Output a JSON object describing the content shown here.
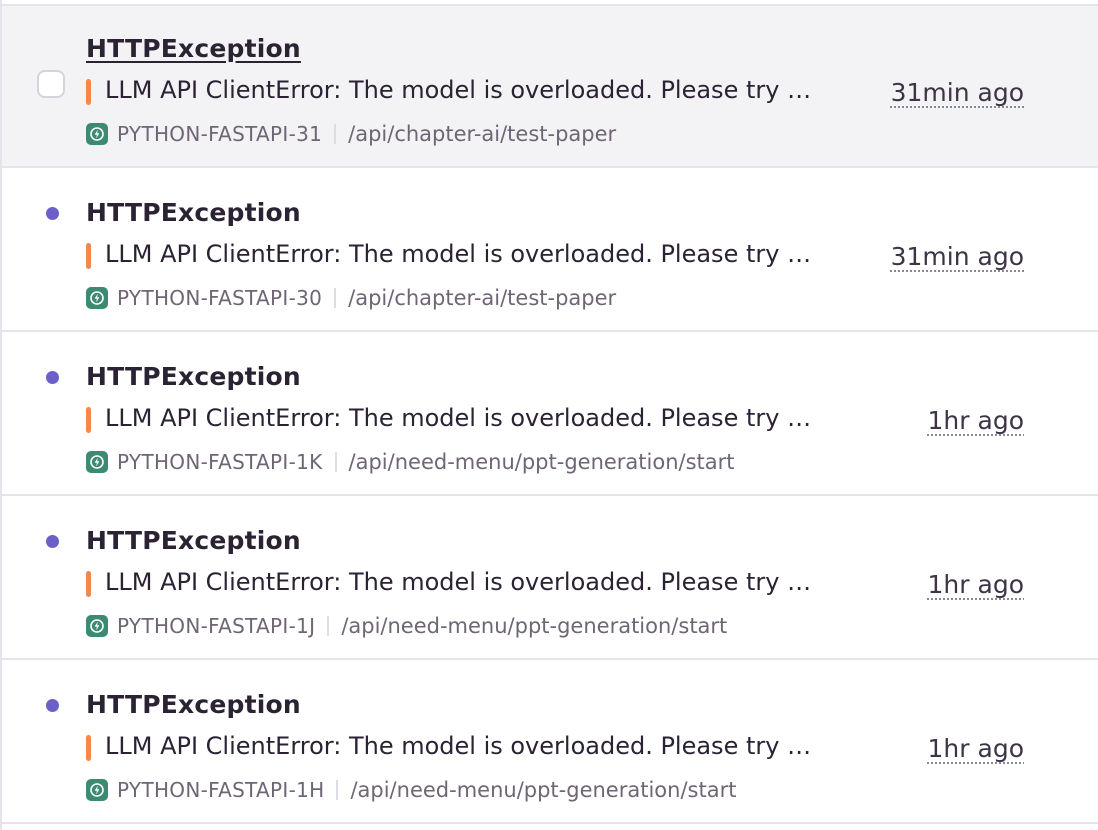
{
  "issues": [
    {
      "title": "HTTPException",
      "message": "LLM API ClientError: The model is overloaded. Please try again later.",
      "short_id": "PYTHON-FASTAPI-31",
      "culprit": "/api/chapter-ai/test-paper",
      "time": "31min ago",
      "state": "hovered",
      "level_color": "#f2884e"
    },
    {
      "title": "HTTPException",
      "message": "LLM API ClientError: The model is overloaded. Please try again later.",
      "short_id": "PYTHON-FASTAPI-30",
      "culprit": "/api/chapter-ai/test-paper",
      "time": "31min ago",
      "state": "unread",
      "level_color": "#f2884e"
    },
    {
      "title": "HTTPException",
      "message": "LLM API ClientError: The model is overloaded. Please try again later.",
      "short_id": "PYTHON-FASTAPI-1K",
      "culprit": "/api/need-menu/ppt-generation/start",
      "time": "1hr ago",
      "state": "unread",
      "level_color": "#f2884e"
    },
    {
      "title": "HTTPException",
      "message": "LLM API ClientError: The model is overloaded. Please try again later.",
      "short_id": "PYTHON-FASTAPI-1J",
      "culprit": "/api/need-menu/ppt-generation/start",
      "time": "1hr ago",
      "state": "unread",
      "level_color": "#f2884e"
    },
    {
      "title": "HTTPException",
      "message": "LLM API ClientError: The model is overloaded. Please try again later.",
      "short_id": "PYTHON-FASTAPI-1H",
      "culprit": "/api/need-menu/ppt-generation/start",
      "time": "1hr ago",
      "state": "unread",
      "level_color": "#f2884e"
    }
  ],
  "colors": {
    "unread_dot": "#6c5fc7",
    "level_error": "#f2884e",
    "project_icon": "#3c8a72",
    "hover_bg": "#f3f2f4"
  },
  "icons": {
    "project": "python-fastapi-bolt-icon"
  }
}
